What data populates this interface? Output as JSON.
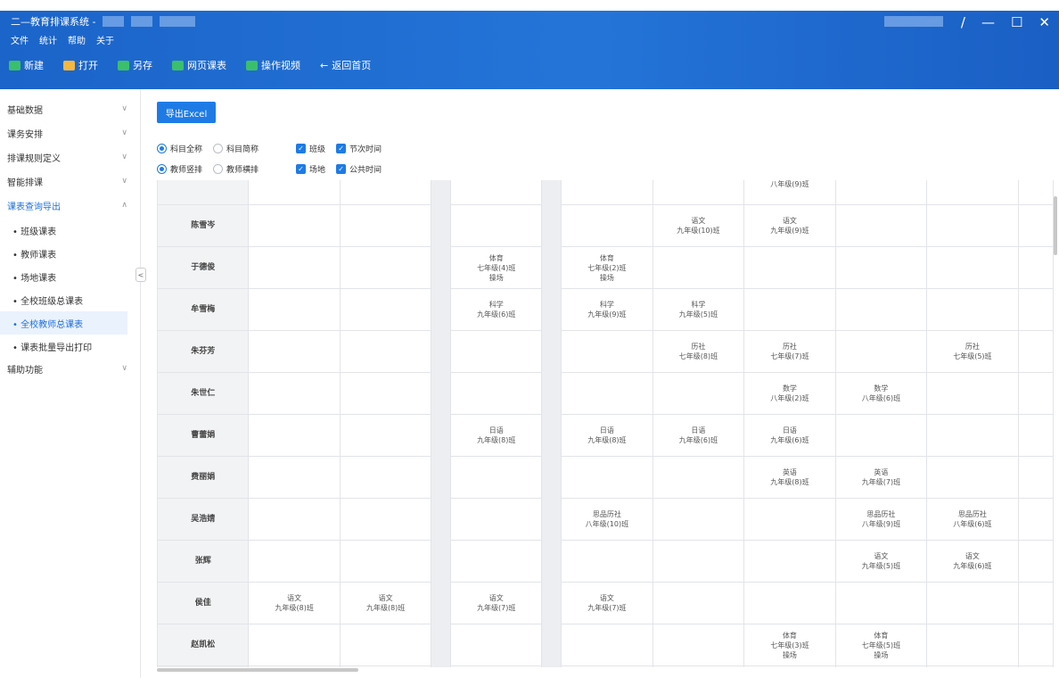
{
  "window": {
    "title": "二—教育排课系统 -",
    "controls": [
      "/",
      "—",
      "☐",
      "✕"
    ]
  },
  "menu": [
    "文件",
    "统计",
    "帮助",
    "关于"
  ],
  "toolbar": [
    {
      "label": "新建",
      "icon": "new-file-icon",
      "color": "#3bbf6b"
    },
    {
      "label": "打开",
      "icon": "folder-icon",
      "color": "#f4b740"
    },
    {
      "label": "另存",
      "icon": "save-as-icon",
      "color": "#3bbf6b"
    },
    {
      "label": "网页课表",
      "icon": "web-table-icon",
      "color": "#3bbf6b"
    },
    {
      "label": "操作视频",
      "icon": "video-icon",
      "color": "#3bbf6b"
    },
    {
      "label": "返回首页",
      "icon": "back-arrow-icon",
      "color": "#ffffff"
    }
  ],
  "sidebar": {
    "groups": [
      {
        "label": "基础数据",
        "chevron": "∨"
      },
      {
        "label": "课务安排",
        "chevron": "∨"
      },
      {
        "label": "排课规则定义",
        "chevron": "∨"
      },
      {
        "label": "智能排课",
        "chevron": "∨"
      },
      {
        "label": "课表查询导出",
        "chevron": "∧"
      }
    ],
    "sub_items": [
      "• 班级课表",
      "• 教师课表",
      "• 场地课表",
      "• 全校班级总课表",
      "• 全校教师总课表",
      "• 课表批量导出打印"
    ],
    "active_sub": 4,
    "last_group": {
      "label": "辅助功能",
      "chevron": "∨"
    },
    "collapse": "<"
  },
  "main": {
    "export_label": "导出Excel",
    "options_row1": [
      {
        "type": "radio",
        "label": "科目全称",
        "on": true
      },
      {
        "type": "radio",
        "label": "科目简称",
        "on": false
      },
      {
        "type": "check",
        "label": "班级",
        "on": true
      },
      {
        "type": "check",
        "label": "节次时间",
        "on": true
      }
    ],
    "options_row2": [
      {
        "type": "radio",
        "label": "教师竖排",
        "on": true
      },
      {
        "type": "radio",
        "label": "教师横排",
        "on": false
      },
      {
        "type": "check",
        "label": "场地",
        "on": true
      },
      {
        "type": "check",
        "label": "公共时间",
        "on": true
      }
    ]
  },
  "schedule": {
    "rows": [
      {
        "teacher": "",
        "cells": [
          "",
          "",
          "",
          "",
          "",
          "八年级(9)班",
          "",
          ""
        ]
      },
      {
        "teacher": "陈雪岑",
        "cells": [
          "",
          "",
          "",
          "",
          "语文\n九年级(10)班",
          "语文\n九年级(9)班",
          "",
          ""
        ]
      },
      {
        "teacher": "于德俊",
        "cells": [
          "",
          "",
          "体育\n七年级(4)班\n操场",
          "体育\n七年级(2)班\n操场",
          "",
          "",
          "",
          ""
        ]
      },
      {
        "teacher": "牟雪梅",
        "cells": [
          "",
          "",
          "科学\n九年级(6)班",
          "科学\n九年级(9)班",
          "科学\n九年级(5)班",
          "",
          "",
          ""
        ]
      },
      {
        "teacher": "朱芬芳",
        "cells": [
          "",
          "",
          "",
          "",
          "历社\n七年级(8)班",
          "历社\n七年级(7)班",
          "",
          "历社\n七年级(5)班"
        ]
      },
      {
        "teacher": "朱世仁",
        "cells": [
          "",
          "",
          "",
          "",
          "",
          "数学\n八年级(2)班",
          "数学\n八年级(6)班",
          ""
        ]
      },
      {
        "teacher": "曹蕾娟",
        "cells": [
          "",
          "",
          "日语\n九年级(8)班",
          "日语\n九年级(8)班",
          "日语\n九年级(6)班",
          "日语\n九年级(6)班",
          "",
          ""
        ]
      },
      {
        "teacher": "费丽娟",
        "cells": [
          "",
          "",
          "",
          "",
          "",
          "英语\n九年级(8)班",
          "英语\n九年级(7)班",
          ""
        ]
      },
      {
        "teacher": "吴浩婧",
        "cells": [
          "",
          "",
          "",
          "思品历社\n八年级(10)班",
          "",
          "",
          "思品历社\n八年级(9)班",
          "思品历社\n八年级(6)班"
        ]
      },
      {
        "teacher": "张辉",
        "cells": [
          "",
          "",
          "",
          "",
          "",
          "",
          "语文\n九年级(5)班",
          "语文\n九年级(6)班"
        ]
      },
      {
        "teacher": "侯佳",
        "cells": [
          "语文\n九年级(8)班",
          "语文\n九年级(8)班",
          "语文\n九年级(7)班",
          "语文\n九年级(7)班",
          "",
          "",
          "",
          ""
        ]
      },
      {
        "teacher": "赵凯松",
        "cells": [
          "",
          "",
          "",
          "",
          "",
          "体育\n七年级(3)班\n操场",
          "体育\n七年级(5)班\n操场",
          ""
        ]
      },
      {
        "teacher": "",
        "cells": [
          "",
          "",
          "",
          "",
          "",
          "",
          "",
          ""
        ]
      }
    ]
  },
  "colors": {
    "header": "#1b64c9",
    "accent": "#1e7be6",
    "active_bg": "#eaf2fd"
  }
}
